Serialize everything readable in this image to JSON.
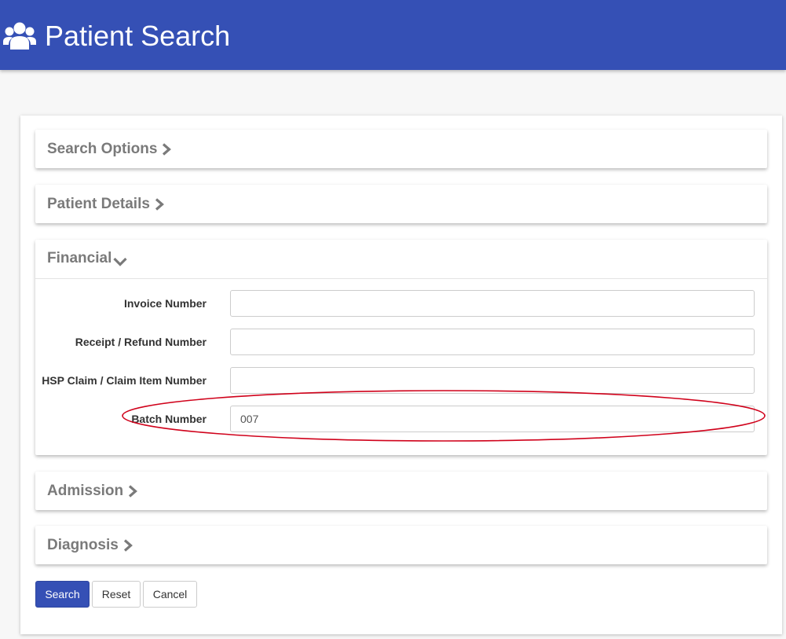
{
  "header": {
    "title": "Patient Search",
    "icon": "users-icon",
    "background": "#3550b5"
  },
  "panels": {
    "search_options": {
      "title": "Search Options",
      "state": "collapsed"
    },
    "patient_details": {
      "title": "Patient Details",
      "state": "collapsed"
    },
    "financial": {
      "title": "Financial",
      "state": "expanded",
      "fields": [
        {
          "label": "Invoice Number",
          "value": ""
        },
        {
          "label": "Receipt / Refund Number",
          "value": ""
        },
        {
          "label": "HSP Claim / Claim Item Number",
          "value": ""
        },
        {
          "label": "Batch Number",
          "value": "007"
        }
      ]
    },
    "admission": {
      "title": "Admission",
      "state": "collapsed"
    },
    "diagnosis": {
      "title": "Diagnosis",
      "state": "collapsed"
    }
  },
  "buttons": {
    "search": "Search",
    "reset": "Reset",
    "cancel": "Cancel"
  },
  "colors": {
    "accent": "#3550b5",
    "annotation": "#d0021b"
  }
}
